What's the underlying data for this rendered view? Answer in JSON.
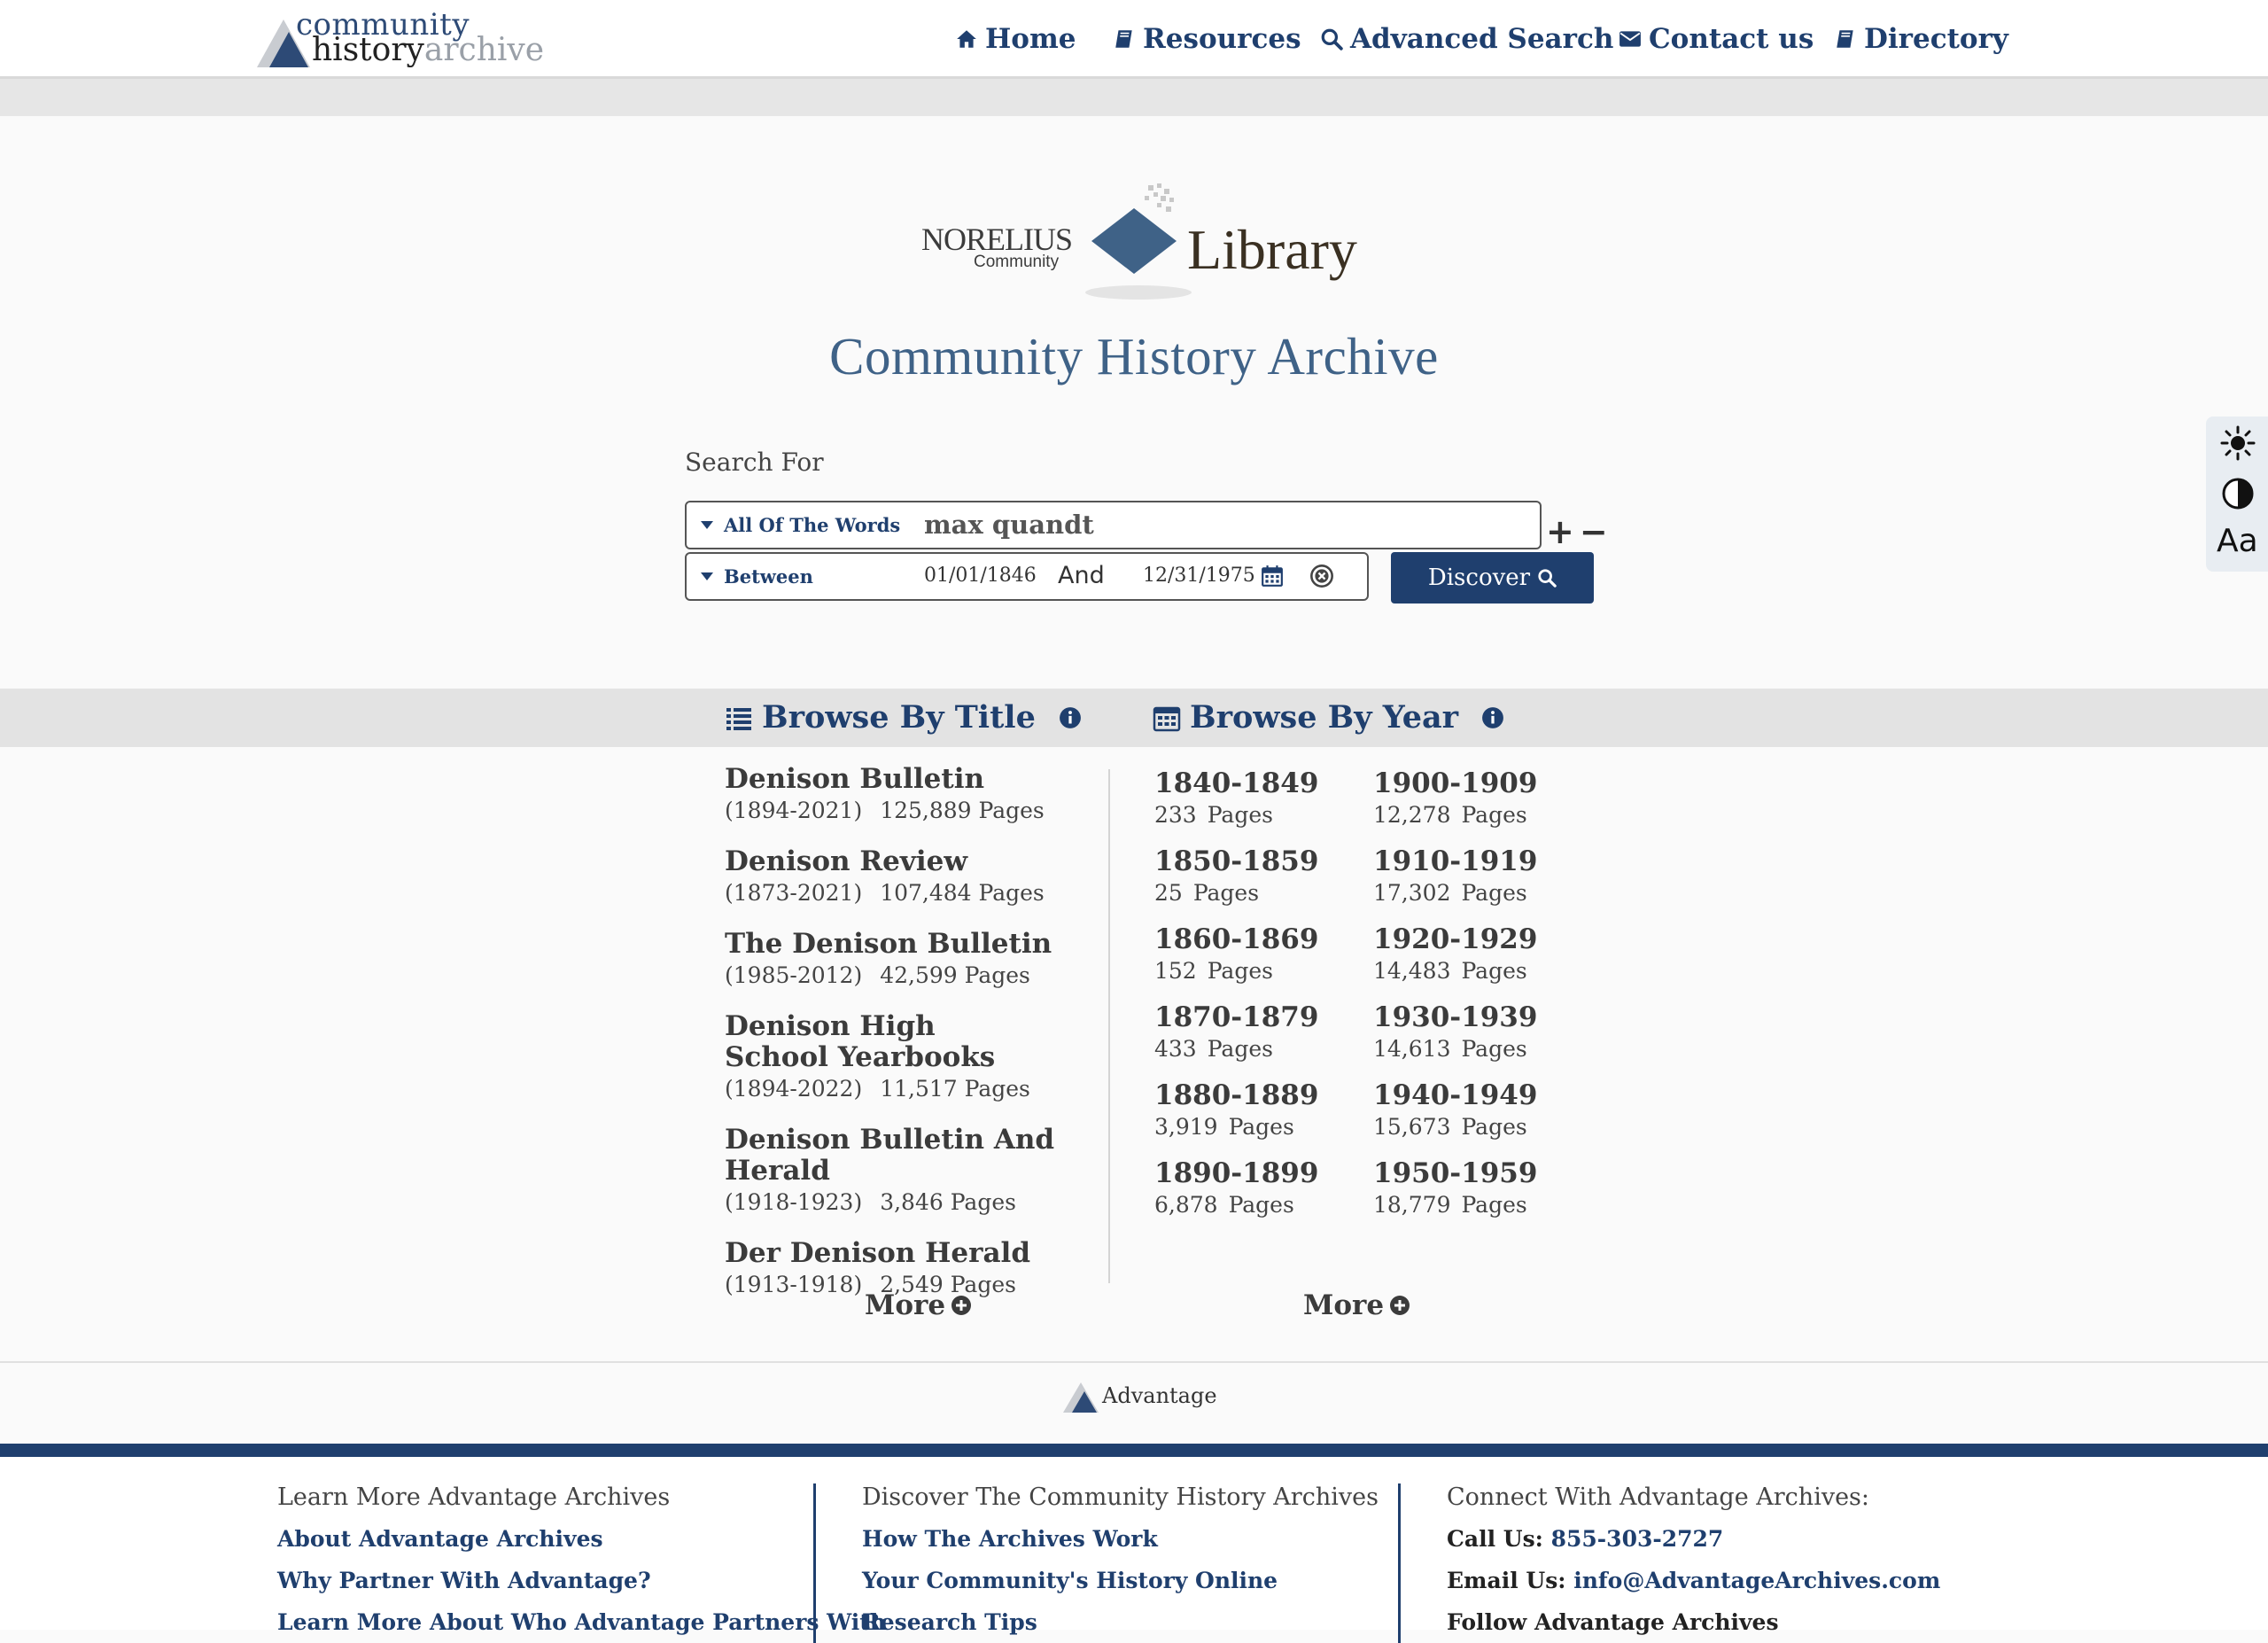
{
  "header": {
    "logo": {
      "line1": "community",
      "line2_a": "history",
      "line2_b": "archive"
    },
    "nav": [
      {
        "label": "Home",
        "icon": "home-icon"
      },
      {
        "label": "Resources",
        "icon": "book-icon"
      },
      {
        "label": "Advanced Search",
        "icon": "search-icon"
      },
      {
        "label": "Contact us",
        "icon": "envelope-icon"
      },
      {
        "label": "Directory",
        "icon": "book-icon"
      }
    ]
  },
  "library_logo": {
    "name": "NORELIUS",
    "sub": "Community",
    "library": "Library"
  },
  "page_title": "Community History Archive",
  "search": {
    "label": "Search For",
    "mode": "All Of The Words",
    "query": "max quandt",
    "date_mode": "Between",
    "date_from": "01/01/1846",
    "date_and": "And",
    "date_to": "12/31/1975",
    "add": "+",
    "remove": "−",
    "button": "Discover"
  },
  "accessibility": {
    "text_size": "Aa"
  },
  "browse_title": {
    "heading": "Browse By Title",
    "items": [
      {
        "name": "Denison Bulletin",
        "years": "(1894-2021)",
        "pages": "125,889 Pages"
      },
      {
        "name": "Denison Review",
        "years": "(1873-2021)",
        "pages": "107,484 Pages"
      },
      {
        "name": "The Denison Bulletin",
        "years": "(1985-2012)",
        "pages": "42,599 Pages"
      },
      {
        "name": "Denison High School Yearbooks",
        "years": "(1894-2022)",
        "pages": "11,517 Pages"
      },
      {
        "name": "Denison Bulletin And Herald",
        "years": "(1918-1923)",
        "pages": "3,846 Pages"
      },
      {
        "name": "Der Denison Herald",
        "years": "(1913-1918)",
        "pages": "2,549 Pages"
      }
    ],
    "more": "More"
  },
  "browse_year": {
    "heading": "Browse By Year",
    "col1": [
      {
        "range": "1840-1849",
        "count": "233",
        "unit": "Pages"
      },
      {
        "range": "1850-1859",
        "count": "25",
        "unit": "Pages"
      },
      {
        "range": "1860-1869",
        "count": "152",
        "unit": "Pages"
      },
      {
        "range": "1870-1879",
        "count": "433",
        "unit": "Pages"
      },
      {
        "range": "1880-1889",
        "count": "3,919",
        "unit": "Pages"
      },
      {
        "range": "1890-1899",
        "count": "6,878",
        "unit": "Pages"
      }
    ],
    "col2": [
      {
        "range": "1900-1909",
        "count": "12,278",
        "unit": "Pages"
      },
      {
        "range": "1910-1919",
        "count": "17,302",
        "unit": "Pages"
      },
      {
        "range": "1920-1929",
        "count": "14,483",
        "unit": "Pages"
      },
      {
        "range": "1930-1939",
        "count": "14,613",
        "unit": "Pages"
      },
      {
        "range": "1940-1949",
        "count": "15,673",
        "unit": "Pages"
      },
      {
        "range": "1950-1959",
        "count": "18,779",
        "unit": "Pages"
      }
    ],
    "more": "More"
  },
  "advantage_logo": "Advantage",
  "footer": {
    "col1": {
      "heading": "Learn More Advantage Archives",
      "links": [
        "About Advantage Archives",
        "Why Partner With Advantage?",
        "Learn More About Who Advantage Partners With"
      ]
    },
    "col2": {
      "heading": "Discover The Community History Archives",
      "links": [
        "How The Archives Work",
        "Your Community's History Online",
        "Research Tips"
      ]
    },
    "col3": {
      "heading": "Connect With Advantage Archives:",
      "call_label": "Call Us:",
      "phone": "855-303-2727",
      "email_label": "Email Us:",
      "email": "info@AdvantageArchives.com",
      "follow": "Follow Advantage Archives"
    }
  },
  "colors": {
    "brand": "#1f3f6e",
    "title": "#3f6287",
    "band": "#e3e3e3"
  }
}
